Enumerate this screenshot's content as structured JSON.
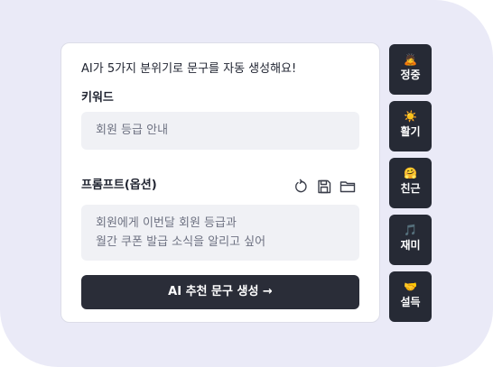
{
  "card": {
    "intro": "AI가 5가지 분위기로 문구를 자동 생성해요!",
    "keyword_label": "키워드",
    "keyword_value": "회원 등급 안내",
    "prompt_label": "프롬프트(옵션)",
    "prompt_line1": "회원에게 이번달 회원 등급과",
    "prompt_line2": "월간 쿠폰 발급 소식을 알리고 싶어",
    "generate_label": "AI 추천 문구 생성 →"
  },
  "icons": {
    "reset": "reset-icon",
    "save": "save-icon",
    "folder": "folder-icon"
  },
  "tones": [
    {
      "emoji": "🙇",
      "label": "정중"
    },
    {
      "emoji": "☀️",
      "label": "활기"
    },
    {
      "emoji": "🤗",
      "label": "친근"
    },
    {
      "emoji": "🎵",
      "label": "재미"
    },
    {
      "emoji": "🤝",
      "label": "설득"
    }
  ],
  "colors": {
    "background": "#eaeaf7",
    "button_dark": "#2a2d38",
    "tone_button": "#262a35",
    "input_bg": "#f0f1f5"
  }
}
